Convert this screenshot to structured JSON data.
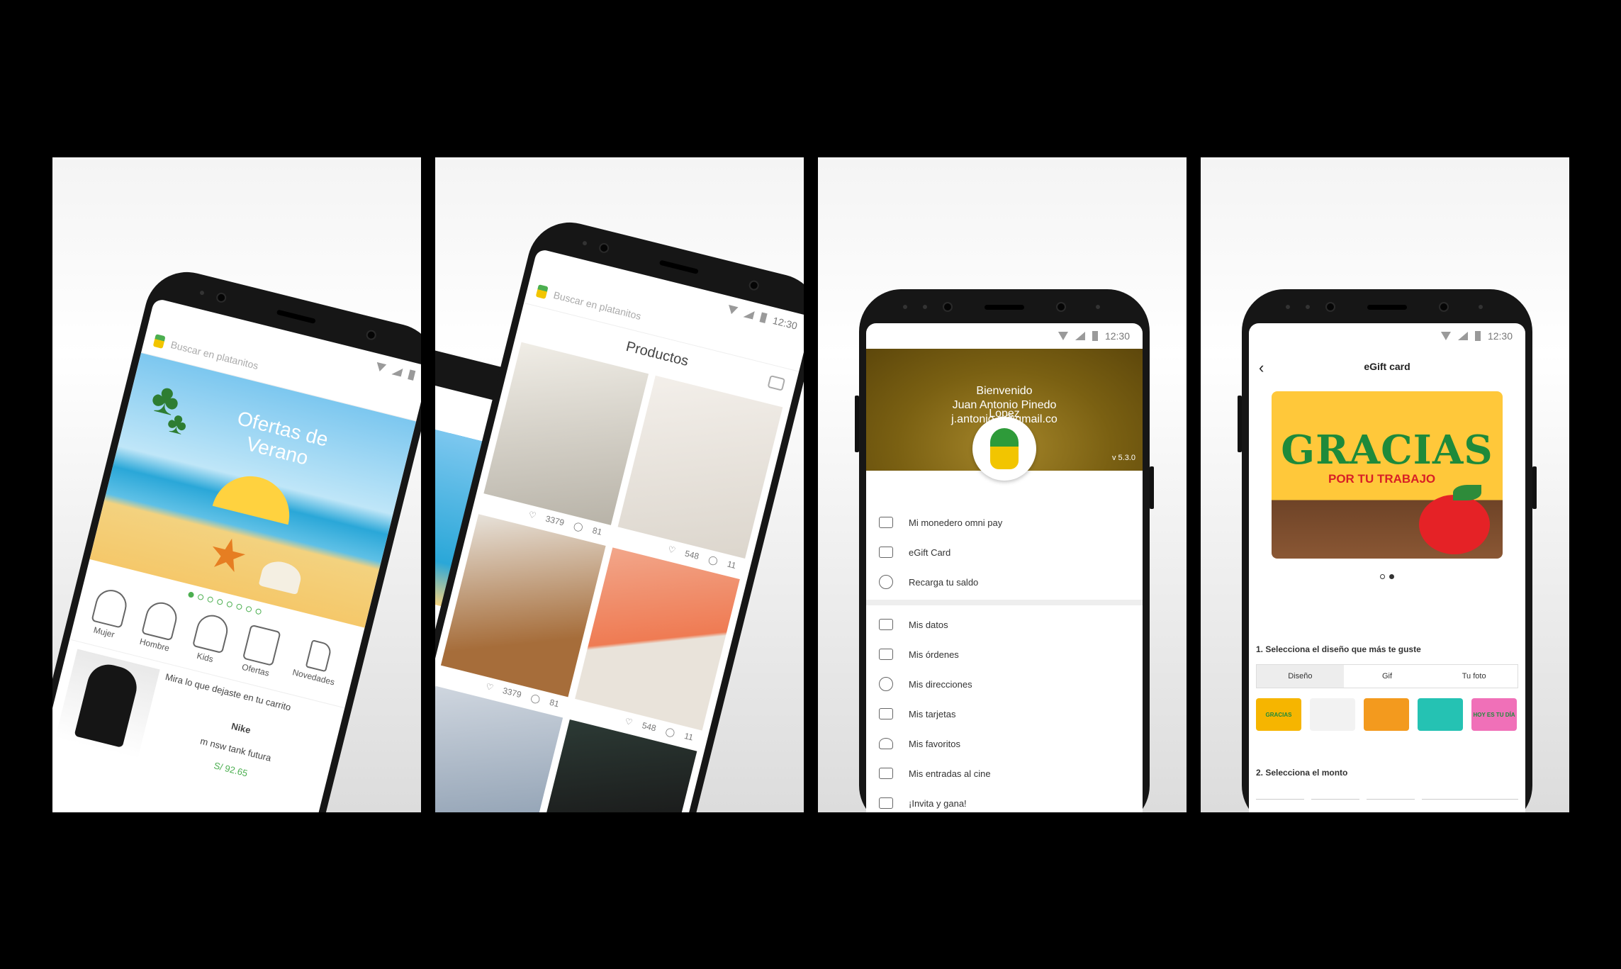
{
  "colors": {
    "brand_green": "#4caf50",
    "price_green": "#4caf50",
    "drawer_header": "#7a6012",
    "gift_yellow": "#ffc83a",
    "gift_green": "#1e8a3a",
    "gift_red": "#d81f26"
  },
  "status": {
    "time": "12:30"
  },
  "screen1": {
    "search_placeholder": "Buscar en platanitos",
    "banner_title_line1": "Ofertas de",
    "banner_title_line2": "Verano",
    "carousel_pages": 8,
    "carousel_active": 1,
    "categories": [
      {
        "label": "Mujer",
        "icon": "woman-icon"
      },
      {
        "label": "Hombre",
        "icon": "man-icon"
      },
      {
        "label": "Kids",
        "icon": "kids-icon"
      },
      {
        "label": "Ofertas",
        "icon": "sale-tag-icon"
      },
      {
        "label": "Novedades",
        "icon": "tag-icon"
      }
    ],
    "cart_reminder": "Mira lo que dejaste en tu carrito",
    "cart_item": {
      "brand": "Nike",
      "name": "m nsw tank futura",
      "price": "S/ 92.65"
    }
  },
  "screen2": {
    "search_placeholder": "Buscar en platanitos",
    "title": "Productos",
    "products": [
      {
        "likes": "3379",
        "comments": "81"
      },
      {
        "likes": "548",
        "comments": "11"
      },
      {
        "likes": "3379",
        "comments": "81"
      },
      {
        "likes": "548",
        "comments": "11"
      },
      {
        "likes": "",
        "comments": ""
      },
      {
        "likes": "",
        "comments": ""
      }
    ]
  },
  "screen3": {
    "welcome": "Bienvenido",
    "user_name_line1": "Juan Antonio Pinedo",
    "user_name_line2": "Lopez",
    "email": "j.antonio.p@gmail.co",
    "version": "v 5.3.0",
    "menu_top": [
      {
        "label": "Mi monedero omni pay",
        "icon": "wallet-icon"
      },
      {
        "label": "eGift Card",
        "icon": "gift-card-icon"
      },
      {
        "label": "Recarga tu saldo",
        "icon": "soles-coin-icon"
      }
    ],
    "menu_bottom": [
      {
        "label": "Mis datos",
        "icon": "id-card-icon"
      },
      {
        "label": "Mis órdenes",
        "icon": "clipboard-icon"
      },
      {
        "label": "Mis direcciones",
        "icon": "location-pin-icon"
      },
      {
        "label": "Mis tarjetas",
        "icon": "credit-card-icon"
      },
      {
        "label": "Mis favoritos",
        "icon": "heart-icon"
      },
      {
        "label": "Mis entradas al cine",
        "icon": "ticket-icon"
      },
      {
        "label": "¡Invita y gana!",
        "icon": "gift-icon"
      }
    ]
  },
  "screen4": {
    "title": "eGift card",
    "card_title": "GRACIAS",
    "card_subtitle": "POR TU TRABAJO",
    "pager_count": 2,
    "pager_active": 2,
    "step1_label": "1. Selecciona el diseño que más te guste",
    "tabs": [
      "Diseño",
      "Gif",
      "Tu foto"
    ],
    "active_tab": "Diseño",
    "thumb_colors": [
      "#f6b500",
      "#f2f2f2",
      "#f39a1e",
      "#25c2b3",
      "#f070b8"
    ],
    "thumb_texts": [
      "GRACIAS",
      "",
      "",
      "",
      "HOY ES TU DÍA"
    ],
    "step2_label": "2. Selecciona el monto"
  }
}
